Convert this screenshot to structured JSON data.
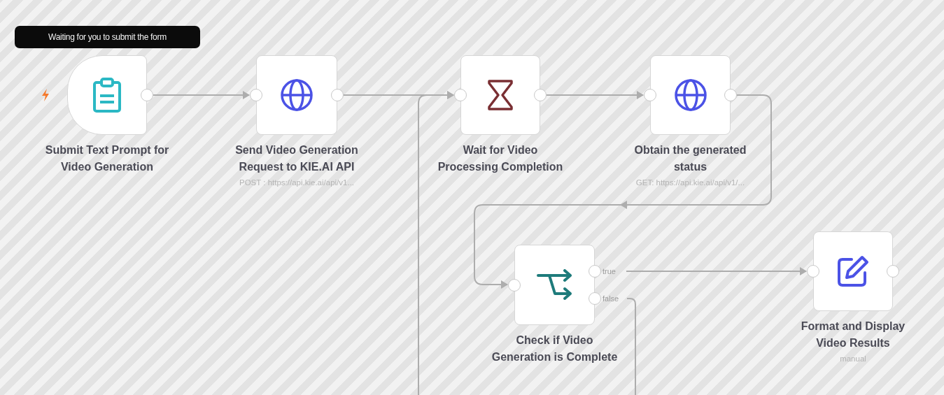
{
  "tooltip": "Waiting for you to submit the form",
  "nodes": [
    {
      "kind": "trigger",
      "title": "Submit Text Prompt for Video Generation"
    },
    {
      "kind": "http",
      "title": "Send Video Generation Request to KIE.AI API",
      "subtitle": "POST : https://api.kie.ai/api/v1..."
    },
    {
      "kind": "wait",
      "title": "Wait for Video Processing Completion"
    },
    {
      "kind": "http",
      "title": "Obtain the generated status",
      "subtitle": "GET: https://api.kie.ai/api/v1/..."
    },
    {
      "kind": "if",
      "title": "Check if Video Generation is Complete",
      "outputs": [
        "true",
        "false"
      ]
    },
    {
      "kind": "edit",
      "title": "Format and Display Video Results",
      "subtitle": "manual"
    }
  ]
}
